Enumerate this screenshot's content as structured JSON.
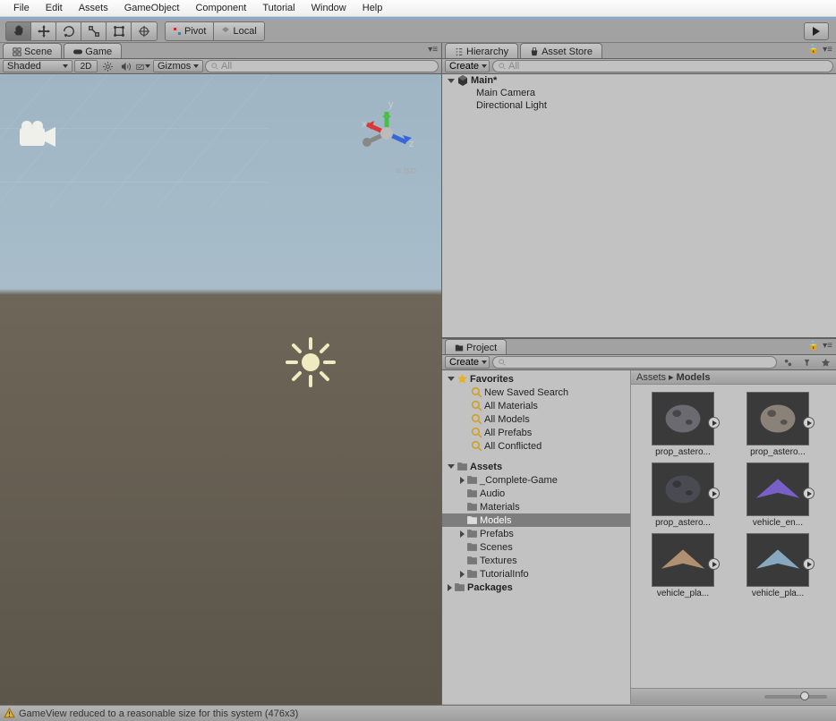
{
  "menu": {
    "file": "File",
    "edit": "Edit",
    "assets": "Assets",
    "gameobject": "GameObject",
    "component": "Component",
    "tutorial": "Tutorial",
    "window": "Window",
    "help": "Help"
  },
  "toolbar": {
    "pivot": "Pivot",
    "local": "Local"
  },
  "tabs": {
    "scene": "Scene",
    "game": "Game",
    "hierarchy": "Hierarchy",
    "assetstore": "Asset Store",
    "project": "Project"
  },
  "scene_tb": {
    "shaded": "Shaded",
    "mode2d": "2D",
    "gizmos": "Gizmos",
    "search_label": "All"
  },
  "scene": {
    "iso": "Iso",
    "axes": {
      "x": "x",
      "y": "y",
      "z": "z"
    }
  },
  "hierarchy": {
    "create": "Create",
    "search_label": "All",
    "scene": "Main*",
    "children": [
      "Main Camera",
      "Directional Light"
    ]
  },
  "project": {
    "create": "Create",
    "favorites": {
      "label": "Favorites",
      "items": [
        "New Saved Search",
        "All Materials",
        "All Models",
        "All Prefabs",
        "All Conflicted"
      ]
    },
    "assets": {
      "label": "Assets",
      "items": [
        {
          "name": "_Complete-Game",
          "expandable": true
        },
        {
          "name": "Audio"
        },
        {
          "name": "Materials"
        },
        {
          "name": "Models",
          "selected": true
        },
        {
          "name": "Prefabs",
          "expandable": true
        },
        {
          "name": "Scenes"
        },
        {
          "name": "Textures"
        },
        {
          "name": "TutorialInfo",
          "expandable": true
        }
      ]
    },
    "packages": "Packages",
    "breadcrumb": [
      "Assets",
      "Models"
    ],
    "grid": [
      "prop_astero...",
      "prop_astero...",
      "prop_astero...",
      "vehicle_en...",
      "vehicle_pla...",
      "vehicle_pla..."
    ]
  },
  "status": {
    "msg": "GameView reduced to a reasonable size for this system (476x3)"
  }
}
